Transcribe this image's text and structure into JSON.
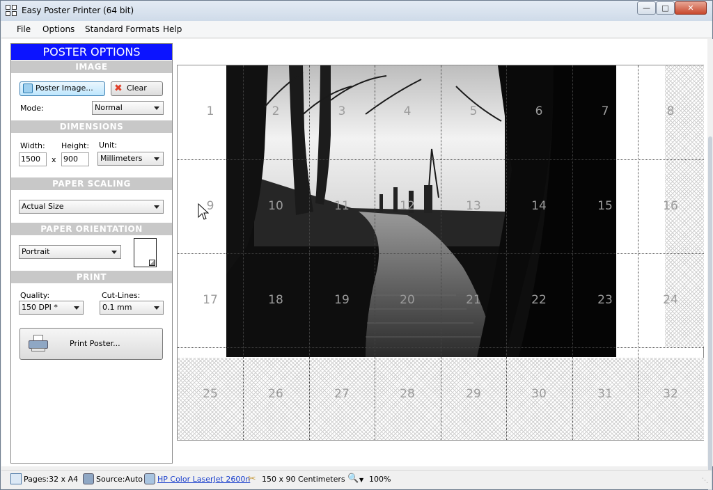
{
  "window": {
    "title": "Easy Poster Printer (64 bit)"
  },
  "menu": [
    "File",
    "Options",
    "Standard Formats",
    "Help"
  ],
  "panel": {
    "title": "POSTER OPTIONS",
    "image": {
      "header": "IMAGE",
      "poster_image_label": "Poster Image...",
      "clear_label": "Clear",
      "mode_label": "Mode:",
      "mode_value": "Normal"
    },
    "dimensions": {
      "header": "DIMENSIONS",
      "width_label": "Width:",
      "height_label": "Height:",
      "unit_label": "Unit:",
      "width_value": "1500",
      "times": "x",
      "height_value": "900",
      "unit_value": "Millimeters"
    },
    "scaling": {
      "header": "PAPER SCALING",
      "value": "Actual Size"
    },
    "orientation": {
      "header": "PAPER ORIENTATION",
      "value": "Portrait"
    },
    "print": {
      "header": "PRINT",
      "quality_label": "Quality:",
      "cutlines_label": "Cut-Lines:",
      "quality_value": "150 DPI *",
      "cutlines_value": "0.1 mm",
      "print_button": "Print Poster..."
    }
  },
  "preview": {
    "pages": [
      "1",
      "2",
      "3",
      "4",
      "5",
      "6",
      "7",
      "8",
      "9",
      "10",
      "11",
      "12",
      "13",
      "14",
      "15",
      "16",
      "17",
      "18",
      "19",
      "20",
      "21",
      "22",
      "23",
      "24",
      "25",
      "26",
      "27",
      "28",
      "29",
      "30",
      "31",
      "32"
    ],
    "columns": 8,
    "rows": 4
  },
  "status": {
    "pages": "Pages:32 x A4",
    "source": "Source:Auto",
    "printer": "HP Color LaserJet 2600n",
    "size": "150 x 90 Centimeters",
    "zoom": "100%"
  },
  "colors": {
    "panel_title_bg": "#0c14ff",
    "section_header_bg": "#c8c8c8",
    "link": "#1a3fcc"
  }
}
